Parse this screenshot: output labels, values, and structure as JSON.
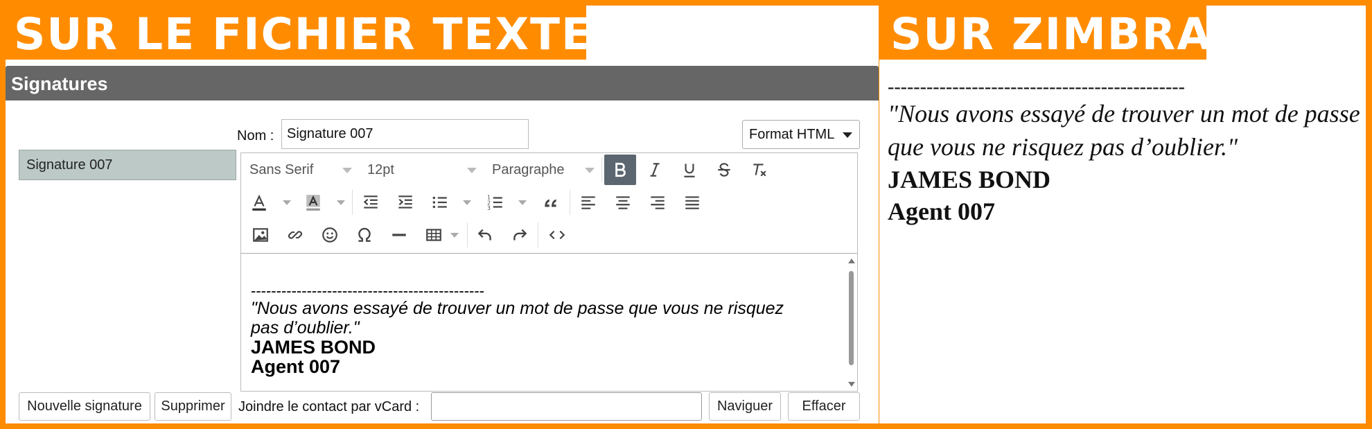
{
  "banners": {
    "left": "SUR LE FICHIER TEXTE",
    "right": "SUR ZIMBRA"
  },
  "colors": {
    "accent": "#ff8c00",
    "header_bg": "#666666",
    "selected_item_bg": "#bcc9c6",
    "bold_active_bg": "#5b6670"
  },
  "signatures": {
    "header": "Signatures",
    "list": [
      "Signature 007"
    ],
    "nom_label": "Nom :",
    "nom_value": "Signature 007",
    "format": "Format HTML"
  },
  "toolbar": {
    "font_family": "Sans Serif",
    "font_size": "12pt",
    "block_format": "Paragraphe",
    "icons_row1": [
      "bold-icon",
      "italic-icon",
      "underline-icon",
      "strikethrough-icon",
      "clear-format-icon"
    ],
    "icons_row2": [
      "text-color-icon",
      "background-color-icon",
      "outdent-icon",
      "indent-icon",
      "bullet-list-icon",
      "numbered-list-icon",
      "blockquote-icon",
      "align-left-icon",
      "align-center-icon",
      "align-right-icon",
      "justify-icon"
    ],
    "icons_row3": [
      "image-icon",
      "link-icon",
      "emoticon-icon",
      "special-char-icon",
      "horizontal-rule-icon",
      "table-icon",
      "undo-icon",
      "redo-icon",
      "source-code-icon"
    ]
  },
  "editor_content": {
    "dashes": "----------------------------------------------",
    "quote": "\"Nous avons essayé de trouver un mot de passe que vous ne risquez pas d’oublier.\"",
    "name": "JAMES BOND",
    "agent": "Agent 007"
  },
  "buttons": {
    "new_signature": "Nouvelle signature",
    "delete": "Supprimer",
    "vcard_label": "Joindre le contact par vCard :",
    "vcard_value": "",
    "browse": "Naviguer",
    "clear": "Effacer"
  },
  "zimbra_preview": {
    "dashes": "----------------------------------------------",
    "quote": "\"Nous avons essayé de trouver un mot de passe que vous ne risquez pas d’oublier.\"",
    "name": "JAMES BOND",
    "agent": "Agent 007"
  }
}
